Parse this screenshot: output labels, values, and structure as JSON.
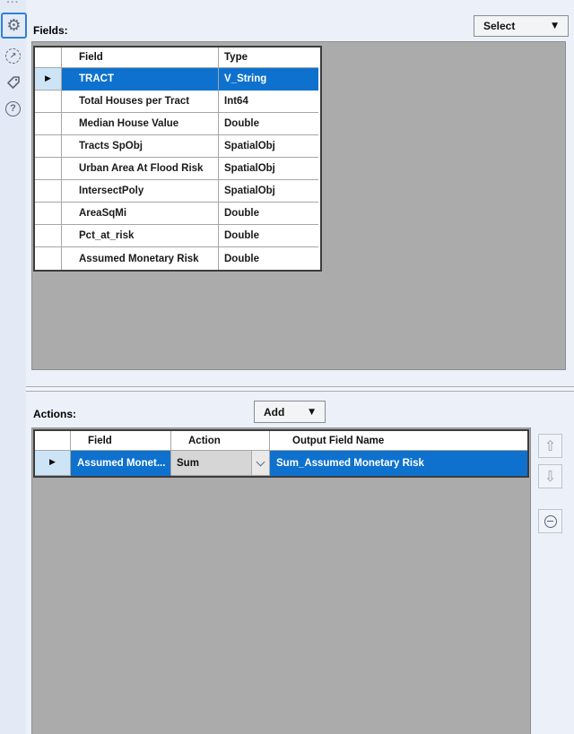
{
  "icons": {
    "overflow": "···",
    "gear": "⚙",
    "run_arrow": "↗",
    "help": "?",
    "caret_down": "▼",
    "row_marker": "▶",
    "up_arrow": "⇧",
    "down_arrow": "⇩"
  },
  "fields_section": {
    "label": "Fields:",
    "select_button_label": "Select",
    "columns": [
      "Field",
      "Type"
    ],
    "selected_row_index": 0,
    "rows": [
      {
        "field": "TRACT",
        "type": "V_String"
      },
      {
        "field": "Total Houses per Tract",
        "type": "Int64"
      },
      {
        "field": "Median House Value",
        "type": "Double"
      },
      {
        "field": "Tracts SpObj",
        "type": "SpatialObj"
      },
      {
        "field": "Urban Area At Flood Risk",
        "type": "SpatialObj"
      },
      {
        "field": "IntersectPoly",
        "type": "SpatialObj"
      },
      {
        "field": "AreaSqMi",
        "type": "Double"
      },
      {
        "field": "Pct_at_risk",
        "type": "Double"
      },
      {
        "field": "Assumed Monetary Risk",
        "type": "Double"
      }
    ]
  },
  "actions_section": {
    "label": "Actions:",
    "add_button_label": "Add",
    "columns": [
      "Field",
      "Action",
      "Output Field Name"
    ],
    "selected_row_index": 0,
    "rows": [
      {
        "field": "Assumed Monet...",
        "action": "Sum",
        "output": "Sum_Assumed Monetary Risk"
      }
    ]
  },
  "colors": {
    "selection_blue": "#0E71CE",
    "selected_gutter_blue": "#CDE4F6",
    "panel_gray": "#ABABAB",
    "toolbar_accent_blue": "#2F7FD8",
    "background": "#ECF0F9"
  }
}
